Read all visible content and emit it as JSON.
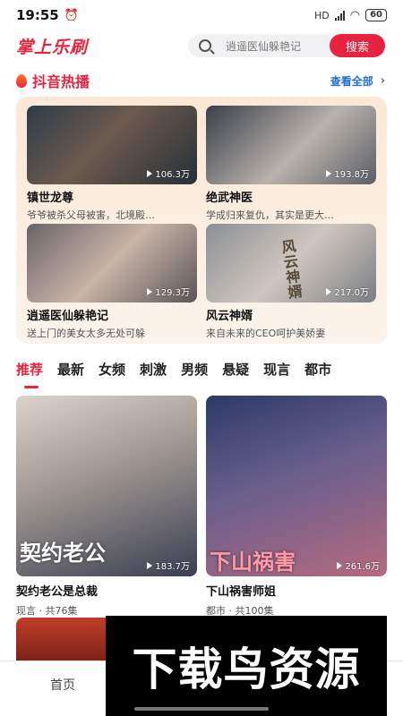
{
  "status": {
    "time": "19:55",
    "network": "HD",
    "battery": "60"
  },
  "header": {
    "app_title": "掌上乐刷",
    "search_placeholder": "逍遥医仙躲艳记",
    "search_button": "搜索"
  },
  "hot": {
    "title": "抖音热播",
    "view_all": "查看全部",
    "items": [
      {
        "name": "镇世龙尊",
        "desc": "爷爷被杀父母被害，北境殿…",
        "plays": "106.3万"
      },
      {
        "name": "绝武神医",
        "desc": "学成归来复仇，其实是更大…",
        "plays": "193.8万"
      },
      {
        "name": "逍遥医仙躲艳记",
        "desc": "送上门的美女太多无处可躲",
        "plays": "129.3万"
      },
      {
        "name": "风云神婿",
        "desc": "来自未来的CEO呵护美娇妻",
        "plays": "217.0万"
      }
    ]
  },
  "tabs": [
    "推荐",
    "最新",
    "女频",
    "刺激",
    "男频",
    "悬疑",
    "现言",
    "都市"
  ],
  "recommend": [
    {
      "name": "契约老公是总裁",
      "meta": "现言 · 共76集",
      "plays": "183.7万",
      "overlay": "契约老公"
    },
    {
      "name": "下山祸害师姐",
      "meta": "都市 · 共100集",
      "plays": "261.6万",
      "overlay": "下山祸害"
    }
  ],
  "thumb_text": {
    "fengyun": "风云神婿"
  },
  "bottom_nav": {
    "home": "首页"
  },
  "watermark": "下载鸟资源",
  "colors": {
    "accent": "#e8233f",
    "link": "#1f6fd6"
  }
}
